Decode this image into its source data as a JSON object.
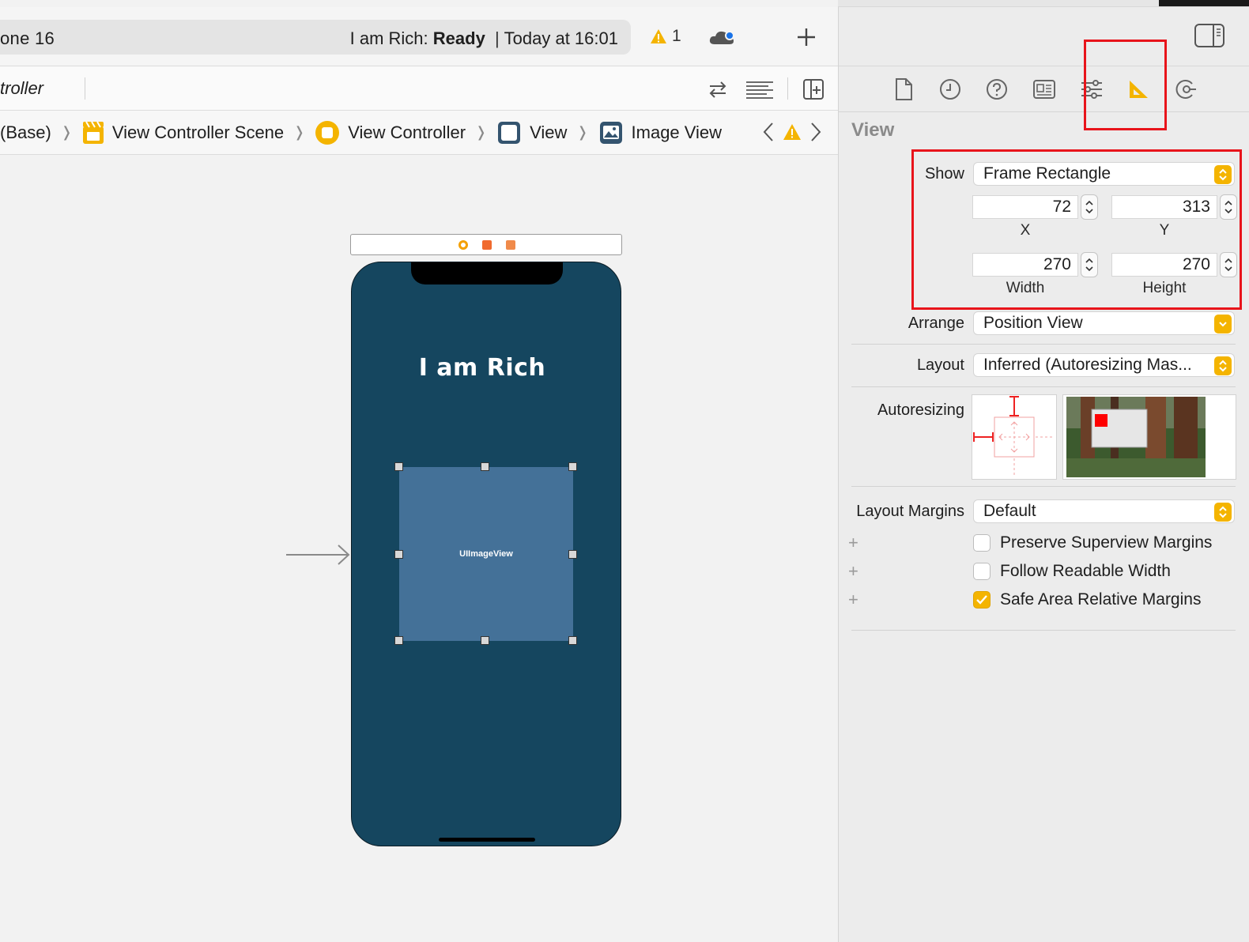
{
  "toolbar": {
    "scheme_name": "one 16",
    "status_app": "I am Rich:",
    "status_state": "Ready",
    "status_separator": "|",
    "status_time": "Today at 16:01",
    "warning_count": "1"
  },
  "jumpbar": {
    "file_name": "troller"
  },
  "breadcrumb": {
    "items": [
      "(Base)",
      "View Controller Scene",
      "View Controller",
      "View",
      "Image View"
    ]
  },
  "canvas": {
    "app_title": "I am Rich",
    "image_view_label": "UIImageView"
  },
  "inspector": {
    "section_title": "View",
    "show_label": "Show",
    "show_value": "Frame Rectangle",
    "x_value": "72",
    "y_value": "313",
    "width_value": "270",
    "height_value": "270",
    "x_caption": "X",
    "y_caption": "Y",
    "width_caption": "Width",
    "height_caption": "Height",
    "arrange_label": "Arrange",
    "arrange_value": "Position View",
    "layout_label": "Layout",
    "layout_value": "Inferred (Autoresizing Mas...",
    "autoresizing_label": "Autoresizing",
    "margins_label": "Layout Margins",
    "margins_value": "Default",
    "checks": [
      {
        "label": "Preserve Superview Margins",
        "checked": false
      },
      {
        "label": "Follow Readable Width",
        "checked": false
      },
      {
        "label": "Safe Area Relative Margins",
        "checked": true
      }
    ]
  },
  "colors": {
    "accent": "#f4b400",
    "highlight": "#e8141b",
    "phone_background": "#15465f",
    "image_view": "#447198"
  },
  "icons": [
    "warning-icon",
    "cloud-icon",
    "add-icon",
    "swap-icon",
    "lines-icon",
    "add-editor-icon",
    "storyboard-icon",
    "view-controller-icon",
    "view-icon",
    "image-view-icon",
    "file-icon",
    "history-icon",
    "help-icon",
    "identity-icon",
    "attributes-icon",
    "size-icon",
    "connections-icon",
    "sidebar-icon"
  ]
}
